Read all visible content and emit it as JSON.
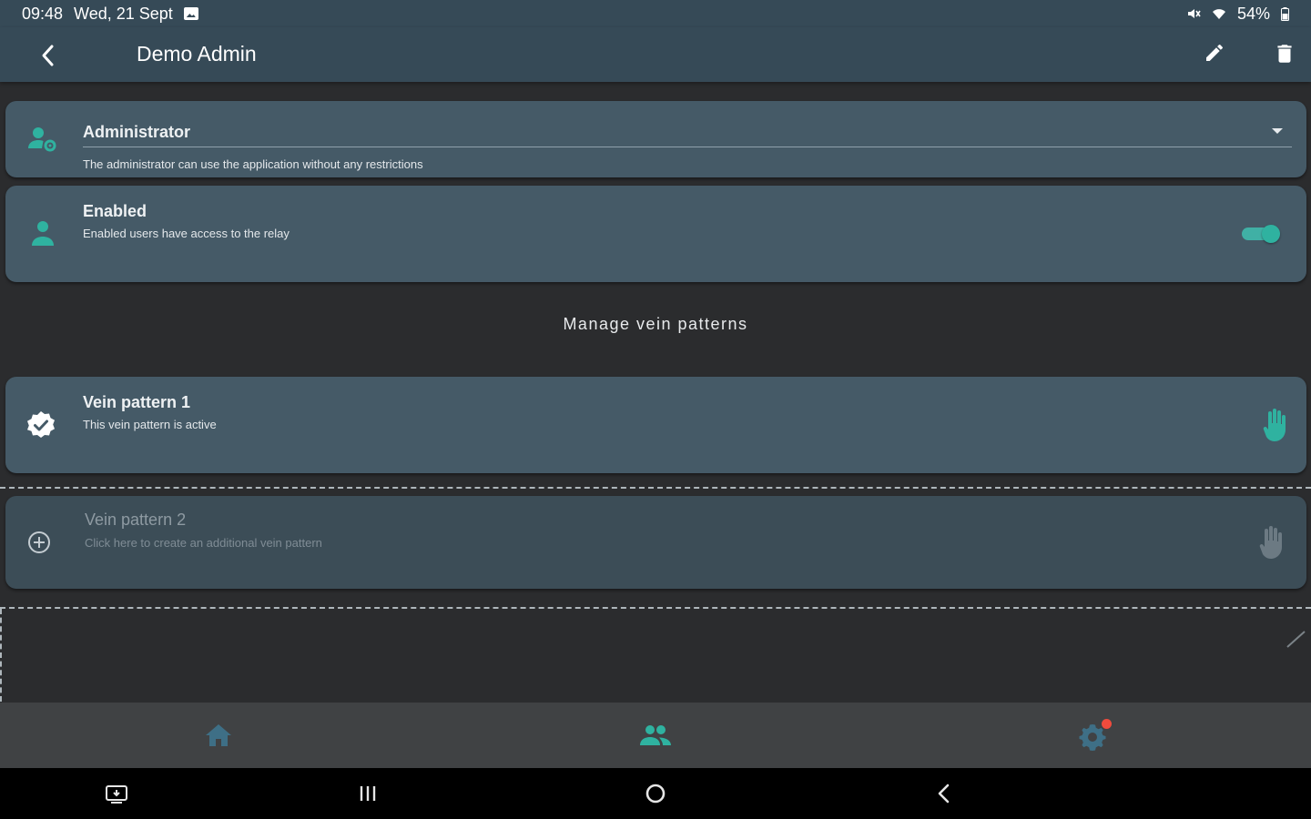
{
  "status_bar": {
    "time": "09:48",
    "date": "Wed, 21 Sept",
    "battery": "54%"
  },
  "app_bar": {
    "title": "Demo Admin",
    "icons": [
      "back-arrow-icon",
      "edit-pencil-icon",
      "trash-icon"
    ]
  },
  "role": {
    "value": "Administrator",
    "description": "The administrator can use the application without any restrictions"
  },
  "enabled": {
    "title": "Enabled",
    "description": "Enabled users have access to the relay",
    "toggle_on": true
  },
  "section": {
    "title": "Manage vein patterns"
  },
  "vein_patterns": [
    {
      "title": "Vein pattern 1",
      "description": "This vein pattern is active",
      "active": true
    },
    {
      "title": "Vein pattern 2",
      "description": "Click here to create an additional vein pattern",
      "active": false
    }
  ],
  "bottom_nav": {
    "items": [
      "home-icon",
      "users-icon",
      "settings-icon"
    ],
    "active": "users-icon",
    "settings_has_notification": true
  },
  "colors": {
    "accent": "#2fb2a0",
    "card": "#455a67",
    "app_bar": "#364a57",
    "background": "#2b2c2e",
    "notification": "#ef4b3d"
  }
}
